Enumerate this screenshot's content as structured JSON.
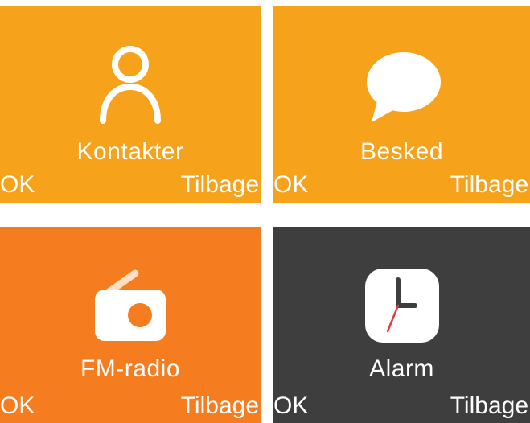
{
  "colors": {
    "tile_amber": "#F7A21B",
    "tile_orange": "#F57C1F",
    "tile_dark": "#3E3E3E",
    "icon_white": "#FFFFFF",
    "alarm_hand": "#E53935"
  },
  "tiles": [
    {
      "label": "Kontakter",
      "icon": "contact-person-icon",
      "color": "#F7A21B",
      "softkey_left": "OK",
      "softkey_right": "Tilbage"
    },
    {
      "label": "Besked",
      "icon": "message-bubble-icon",
      "color": "#F7A21B",
      "softkey_left": "OK",
      "softkey_right": "Tilbage"
    },
    {
      "label": "FM-radio",
      "icon": "radio-icon",
      "color": "#F57C1F",
      "softkey_left": "OK",
      "softkey_right": "Tilbage"
    },
    {
      "label": "Alarm",
      "icon": "alarm-clock-icon",
      "color": "#3E3E3E",
      "softkey_left": "OK",
      "softkey_right": "Tilbage"
    }
  ]
}
